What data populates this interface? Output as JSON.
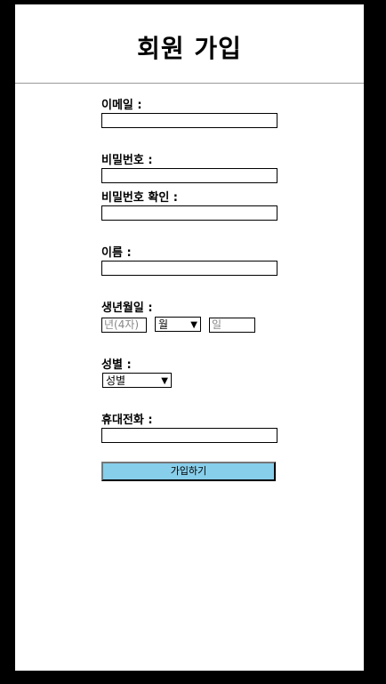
{
  "header": {
    "title": "회원 가입"
  },
  "form": {
    "email_label": "이메일 :",
    "password_label": "비밀번호 :",
    "password_confirm_label": "비밀번호 확인 :",
    "name_label": "이름 :",
    "birth_label": "생년월일 :",
    "birth_year_placeholder": "년(4자)",
    "birth_month_value": "월",
    "birth_day_placeholder": "일",
    "gender_label": "성별 :",
    "gender_value": "성별",
    "phone_label": "휴대전화 :",
    "submit_label": "가입하기"
  },
  "icons": {
    "dropdown": "chevron-down-icon"
  },
  "colors": {
    "submit_bg": "#87ceeb",
    "background": "#000000"
  }
}
